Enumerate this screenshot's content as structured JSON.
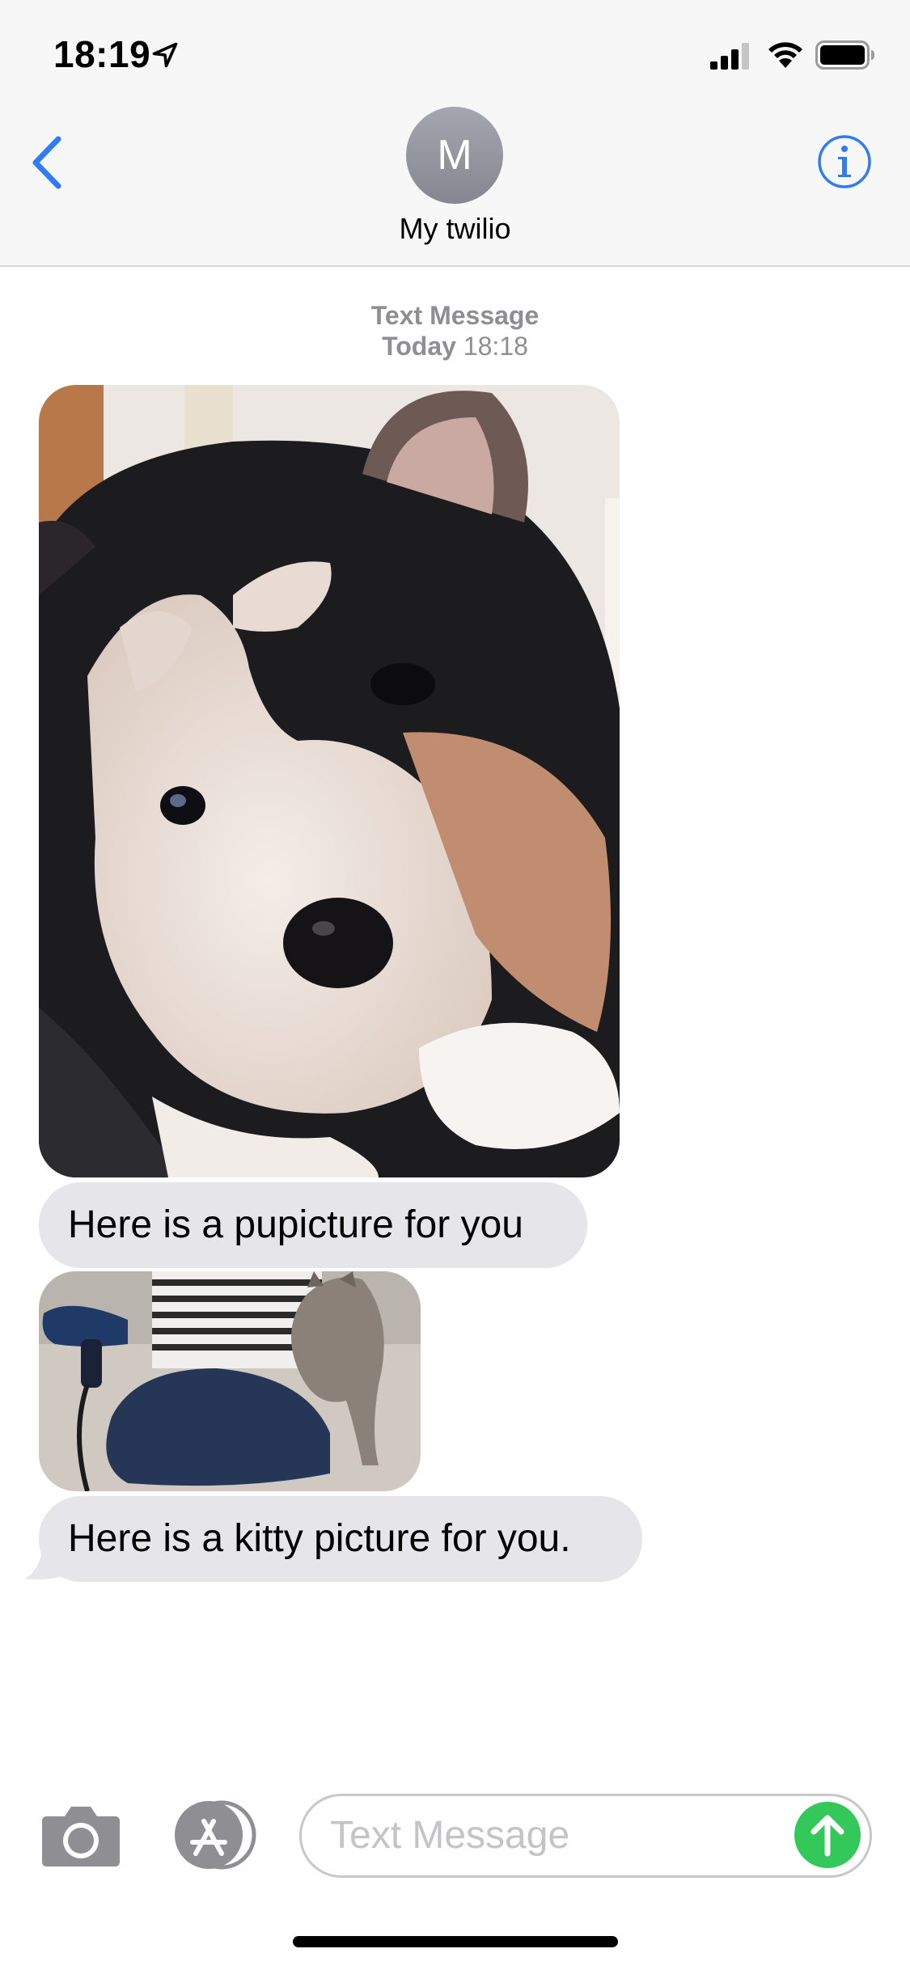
{
  "status_bar": {
    "time": "18:19"
  },
  "header": {
    "avatar_initial": "M",
    "contact_name": "My twilio"
  },
  "conversation": {
    "service_label": "Text Message",
    "day_label": "Today",
    "time_label": "18:18",
    "messages": [
      {
        "type": "image",
        "description_icon": "puppy-photo"
      },
      {
        "type": "text",
        "text": "Here is a pupicture for you"
      },
      {
        "type": "image",
        "description_icon": "kitty-photo"
      },
      {
        "type": "text",
        "text": "Here is a kitty picture for you."
      }
    ]
  },
  "composer": {
    "placeholder": "Text Message"
  },
  "colors": {
    "accent": "#2f7cf6",
    "bubble_gray": "#e5e5ea",
    "send_green": "#34c759",
    "meta_gray": "#8e8e93"
  }
}
